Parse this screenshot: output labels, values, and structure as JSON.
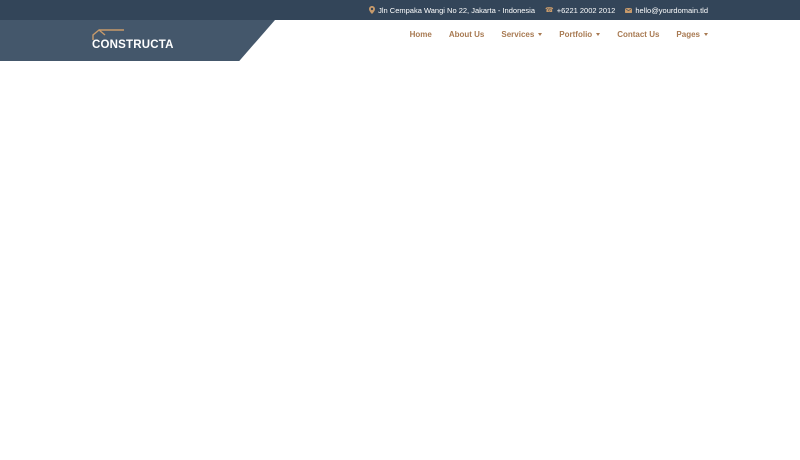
{
  "topbar": {
    "address": "Jln Cempaka Wangi No 22, Jakarta - Indonesia",
    "phone": "+6221 2002 2012",
    "email": "hello@yourdomain.tld",
    "icons": [
      "map-pin-icon",
      "phone-icon",
      "envelope-icon"
    ]
  },
  "brand": {
    "name": "CONSTRUCTA"
  },
  "nav": {
    "items": [
      {
        "label": "Home",
        "has_dropdown": false
      },
      {
        "label": "About Us",
        "has_dropdown": false
      },
      {
        "label": "Services",
        "has_dropdown": true
      },
      {
        "label": "Portfolio",
        "has_dropdown": true
      },
      {
        "label": "Contact Us",
        "has_dropdown": false
      },
      {
        "label": "Pages",
        "has_dropdown": true
      }
    ]
  },
  "colors": {
    "topbar_bg": "#334559",
    "logo_panel_bg": "#44576b",
    "accent": "#c79a6b",
    "nav_text": "#a87a52"
  }
}
